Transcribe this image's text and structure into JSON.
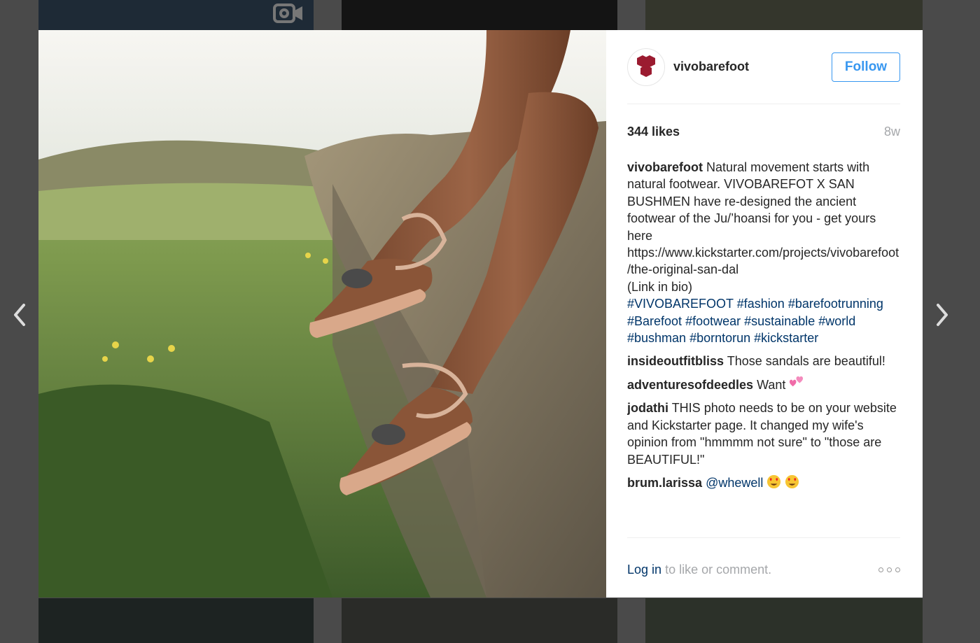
{
  "post": {
    "username": "vivobarefoot",
    "follow_label": "Follow",
    "likes": "344 likes",
    "time": "8w",
    "caption": {
      "user": "vivobarefoot",
      "text": "Natural movement starts with natural footwear. VIVOBAREFOT X SAN BUSHMEN have re-designed the ancient footwear of the Ju/’hoansi for you - get yours here https://www.kickstarter.com/projects/vivobarefoot/the-original-san-dal",
      "note": "(Link in bio)",
      "tags": [
        "#VIVOBAREFOOT",
        "#fashion",
        "#barefootrunning",
        "#Barefoot",
        "#footwear",
        "#sustainable",
        "#world",
        "#bushman",
        "#borntorun",
        "#kickstarter"
      ]
    },
    "comments": [
      {
        "user": "insideoutfitbliss",
        "text": "Those sandals are beautiful!"
      },
      {
        "user": "adventuresofdeedles",
        "text": "Want",
        "emoji": "two-hearts"
      },
      {
        "user": "jodathi",
        "text": "THIS photo needs to be on your website and Kickstarter page. It changed my wife's opinion from \"hmmmm not sure\" to \"those are BEAUTIFUL!\""
      },
      {
        "user": "brum.larissa",
        "mention": "@whewell",
        "emoji": "heart-eyes heart-eyes"
      }
    ],
    "footer": {
      "login_label": "Log in",
      "suffix": "to like or comment."
    }
  },
  "colors": {
    "link": "#003569",
    "follow": "#3897f0",
    "brand": "#9b1b30"
  }
}
